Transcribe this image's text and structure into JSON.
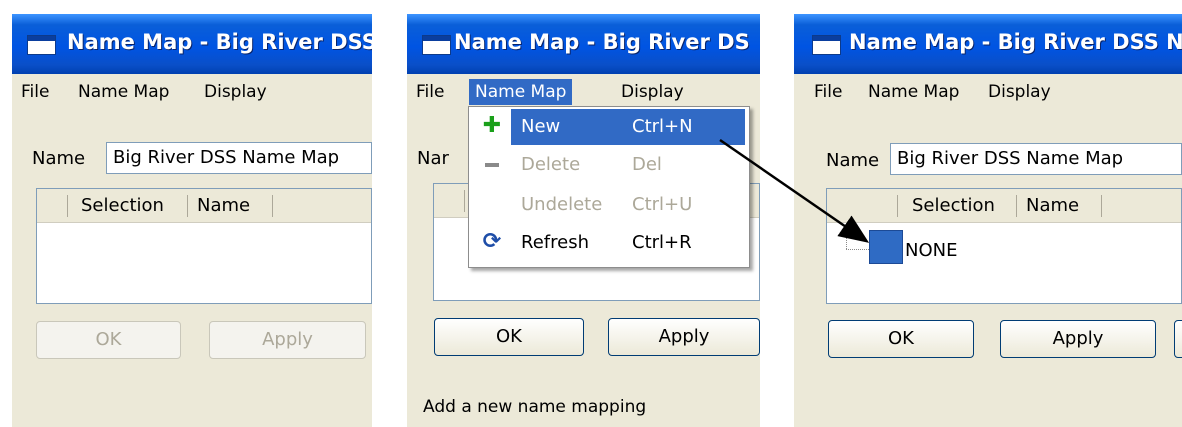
{
  "panels": [
    {
      "title": "Name Map - Big River DSS",
      "menu": [
        "File",
        "Name Map",
        "Display"
      ],
      "name_label": "Name",
      "name_value": "Big River DSS Name Map",
      "columns": [
        "Selection",
        "Name"
      ],
      "ok_label": "OK",
      "apply_label": "Apply"
    },
    {
      "title": "Name Map - Big River DS",
      "menu": [
        "File",
        "Name Map",
        "Display"
      ],
      "name_label": "Nar",
      "ok_label": "OK",
      "apply_label": "Apply",
      "status": "Add a new name mapping",
      "dropdown": [
        {
          "icon": "plus-icon",
          "label": "New",
          "shortcut": "Ctrl+N",
          "enabled": true,
          "highlighted": true
        },
        {
          "icon": "minus-icon",
          "label": "Delete",
          "shortcut": "Del",
          "enabled": false
        },
        {
          "icon": "",
          "label": "Undelete",
          "shortcut": "Ctrl+U",
          "enabled": false
        },
        {
          "icon": "refresh-icon",
          "label": "Refresh",
          "shortcut": "Ctrl+R",
          "enabled": true
        }
      ]
    },
    {
      "title": "Name Map - Big River DSS N",
      "menu": [
        "File",
        "Name Map",
        "Display"
      ],
      "name_label": "Name",
      "name_value": "Big River DSS Name Map",
      "columns": [
        "Selection",
        "Name"
      ],
      "node_label": "NONE",
      "ok_label": "OK",
      "apply_label": "Apply"
    }
  ],
  "colors": {
    "titlebar": "#0054e3",
    "highlight": "#316ac5",
    "window_bg": "#ece9d8",
    "node": "#2f6bc4"
  }
}
